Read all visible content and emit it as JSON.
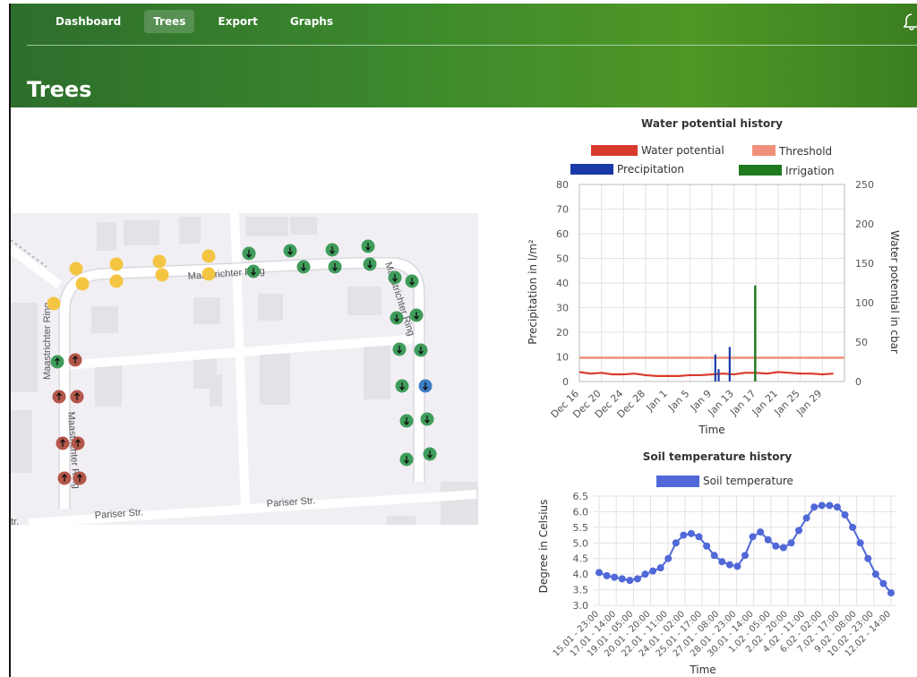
{
  "nav": {
    "items": [
      {
        "label": "Dashboard",
        "active": false
      },
      {
        "label": "Trees",
        "active": true
      },
      {
        "label": "Export",
        "active": false
      },
      {
        "label": "Graphs",
        "active": false
      }
    ],
    "bell_icon": "bell-icon"
  },
  "page": {
    "title": "Trees"
  },
  "map": {
    "street_labels": [
      {
        "text": "Maastrichter Ring"
      },
      {
        "text": "Maastrichter Ring"
      },
      {
        "text": "Maastrichter Ring"
      },
      {
        "text": "Maastrichter Ring"
      },
      {
        "text": "Pariser Str."
      },
      {
        "text": "Pariser Str."
      },
      {
        "text": "tr."
      }
    ],
    "marker_colors": {
      "yellow": "#f4c542",
      "green": "#3f9c5a",
      "red": "#b3574a",
      "blue": "#3c7ec6"
    }
  },
  "chart_data": [
    {
      "type": "line",
      "title": "Water potential history",
      "xlabel": "Time",
      "ylabel_left": "Precipitation in l/m²",
      "ylabel_right": "Water potential in cbar",
      "ylim_left": [
        0,
        80
      ],
      "ylim_right": [
        0,
        250
      ],
      "yticks_left": [
        "0",
        "10",
        "20",
        "30",
        "40",
        "50",
        "60",
        "70",
        "80"
      ],
      "yticks_right": [
        "0",
        "50",
        "100",
        "150",
        "200",
        "250"
      ],
      "x_ticks": [
        "Dec 16",
        "Dec 20",
        "Dec 24",
        "Dec 28",
        "Jan 1",
        "Jan 5",
        "Jan 9",
        "Jan 13",
        "Jan 17",
        "Jan 21",
        "Jan 25",
        "Jan 29"
      ],
      "legend": [
        {
          "name": "Water potential",
          "color": "#d93a2b"
        },
        {
          "name": "Threshold",
          "color": "#f0907a"
        },
        {
          "name": "Precipitation",
          "color": "#1a3aa8"
        },
        {
          "name": "Irrigation",
          "color": "#1f7a1f"
        }
      ],
      "series": [
        {
          "name": "Water potential",
          "axis": "right",
          "x_days": [
            0,
            2,
            4,
            6,
            8,
            10,
            12,
            14,
            16,
            18,
            20,
            22,
            24,
            26,
            28,
            30,
            32,
            34,
            36,
            38,
            40,
            42,
            44,
            46
          ],
          "values": [
            12,
            10,
            11,
            9,
            9,
            10,
            8,
            7,
            7,
            7,
            8,
            8,
            9,
            10,
            9,
            11,
            11,
            10,
            12,
            11,
            10,
            10,
            9,
            10
          ]
        },
        {
          "name": "Threshold",
          "axis": "right",
          "values": [
            30
          ]
        },
        {
          "name": "Precipitation",
          "axis": "left",
          "bars": [
            {
              "day": 24.6,
              "value": 11
            },
            {
              "day": 25.2,
              "value": 5
            },
            {
              "day": 27.2,
              "value": 14
            }
          ]
        },
        {
          "name": "Irrigation",
          "axis": "left",
          "bars": [
            {
              "day": 31.8,
              "value": 39
            }
          ]
        }
      ]
    },
    {
      "type": "line",
      "title": "Soil temperature history",
      "xlabel": "Time",
      "ylabel": "Degree in Celsius",
      "ylim": [
        3.0,
        6.5
      ],
      "yticks": [
        "3.0",
        "3.5",
        "4.0",
        "4.5",
        "5.0",
        "5.5",
        "6.0",
        "6.5"
      ],
      "x_ticks": [
        "15.01 - 23:00",
        "17.01 - 14:00",
        "19.01 - 05:00",
        "20.01 - 20:00",
        "22.01 - 11:00",
        "24.01 - 02:00",
        "25.01 - 17:00",
        "27.01 - 08:00",
        "28.01 - 23:00",
        "30.01 - 14:00",
        "1.02 - 05:00",
        "2.02 - 20:00",
        "4.02 - 11:00",
        "6.02 - 02:00",
        "7.02 - 17:00",
        "9.02 - 08:00",
        "10.02 - 23:00",
        "12.02 - 14:00"
      ],
      "legend": [
        {
          "name": "Soil temperature",
          "color": "#5068d8"
        }
      ],
      "series": [
        {
          "name": "Soil temperature",
          "values": [
            4.05,
            3.95,
            3.9,
            3.85,
            3.8,
            3.85,
            4.0,
            4.1,
            4.2,
            4.5,
            5.0,
            5.25,
            5.3,
            5.2,
            4.9,
            4.6,
            4.4,
            4.3,
            4.25,
            4.6,
            5.2,
            5.35,
            5.1,
            4.9,
            4.85,
            5.0,
            5.4,
            5.8,
            6.15,
            6.2,
            6.2,
            6.15,
            5.9,
            5.5,
            5.0,
            4.5,
            4.0,
            3.7,
            3.4
          ]
        }
      ]
    }
  ]
}
